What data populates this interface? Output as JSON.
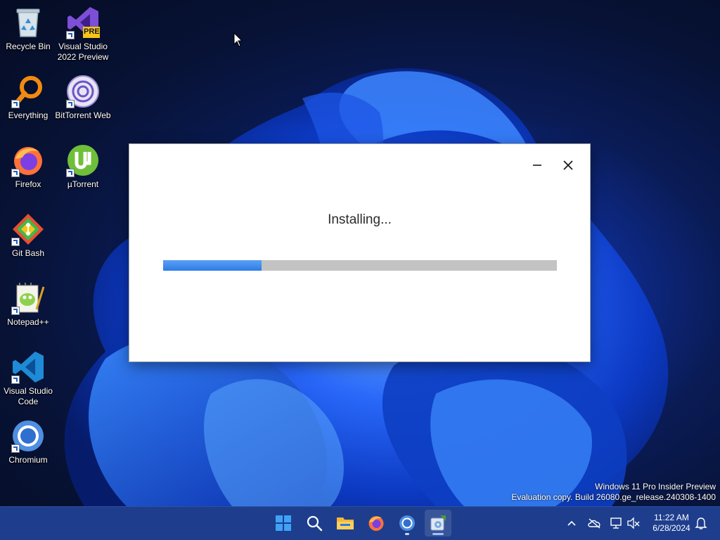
{
  "desktop": {
    "icons": [
      {
        "label": "Recycle Bin",
        "icon": "recycle-bin-icon"
      },
      {
        "label": "Visual Studio 2022 Preview",
        "icon": "visual-studio-preview-icon",
        "badge": "PRE"
      },
      {
        "label": "Everything",
        "icon": "everything-search-icon"
      },
      {
        "label": "BitTorrent Web",
        "icon": "bittorrent-icon"
      },
      {
        "label": "Firefox",
        "icon": "firefox-icon"
      },
      {
        "label": "µTorrent",
        "icon": "utorrent-icon"
      },
      {
        "label": "Git Bash",
        "icon": "git-bash-icon"
      },
      {
        "label": "Notepad++",
        "icon": "notepad-plus-plus-icon"
      },
      {
        "label": "Visual Studio Code",
        "icon": "vscode-icon"
      },
      {
        "label": "Chromium",
        "icon": "chromium-icon"
      }
    ]
  },
  "installer": {
    "status": "Installing...",
    "progress_fraction": 0.25,
    "minimize_icon": "minimize-icon",
    "close_icon": "close-icon",
    "colors": {
      "progress_fill": "#3a86ec",
      "progress_track": "#c3c3c3"
    }
  },
  "watermark": {
    "line1": "Windows 11 Pro Insider Preview",
    "line2": "Evaluation copy. Build 26080.ge_release.240308-1400"
  },
  "taskbar": {
    "apps": [
      {
        "name": "start",
        "icon": "windows-start-icon"
      },
      {
        "name": "search",
        "icon": "search-icon"
      },
      {
        "name": "file-explorer",
        "icon": "folder-icon"
      },
      {
        "name": "firefox",
        "icon": "firefox-icon"
      },
      {
        "name": "chromium",
        "icon": "chromium-icon"
      },
      {
        "name": "installer",
        "icon": "installer-icon",
        "active": true
      }
    ],
    "tray": {
      "time": "11:22 AM",
      "date": "6/28/2024",
      "icons": [
        "chevron-up-icon",
        "onedrive-offline-icon",
        "network-icon",
        "volume-muted-icon",
        "notification-bell-icon"
      ]
    },
    "colors": {
      "background": "#1e3e8d"
    }
  }
}
